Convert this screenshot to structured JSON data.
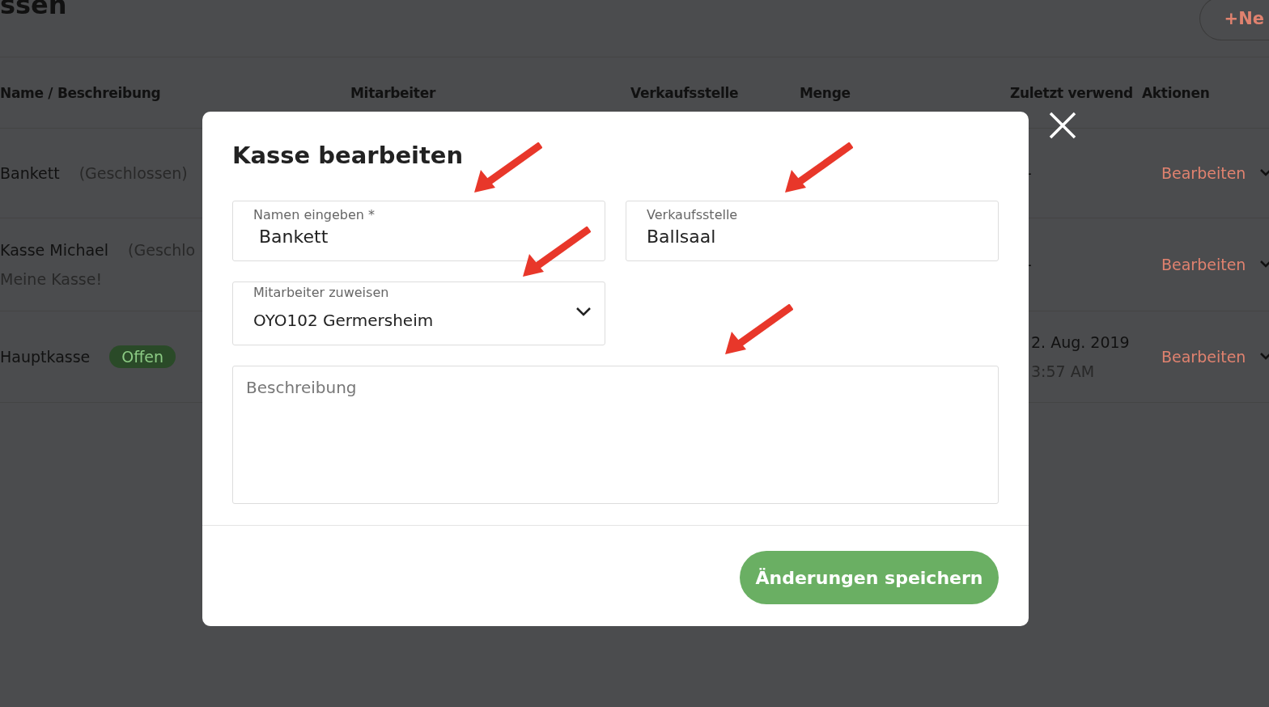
{
  "page": {
    "title": "ssen",
    "new_button": "+Ne"
  },
  "table": {
    "columns": [
      "Name / Beschreibung",
      "Mitarbeiter",
      "Verkaufsstelle",
      "Menge",
      "Zuletzt verwend",
      "Aktionen"
    ],
    "rows": [
      {
        "name": "Bankett",
        "status": "(Geschlossen)",
        "kind": "closed",
        "last_used": [
          "-"
        ],
        "action": "Bearbeiten"
      },
      {
        "name": "Kasse Michael",
        "status": "(Geschlo",
        "kind": "closed",
        "description": "Meine Kasse!",
        "last_used": [
          "-"
        ],
        "action": "Bearbeiten"
      },
      {
        "name": "Hauptkasse",
        "status": "Offen",
        "kind": "open",
        "last_used": [
          "2. Aug. 2019",
          "3:57 AM"
        ],
        "action": "Bearbeiten"
      }
    ]
  },
  "modal": {
    "title": "Kasse bearbeiten",
    "name_field": {
      "label": "Namen eingeben *",
      "value": "Bankett"
    },
    "outlet_field": {
      "label": "Verkaufsstelle",
      "value": "Ballsaal"
    },
    "staff_select": {
      "label": "Mitarbeiter zuweisen",
      "value": "OYO102 Germersheim"
    },
    "description_field": {
      "placeholder": "Beschreibung"
    },
    "save_button": "Änderungen speichern"
  }
}
